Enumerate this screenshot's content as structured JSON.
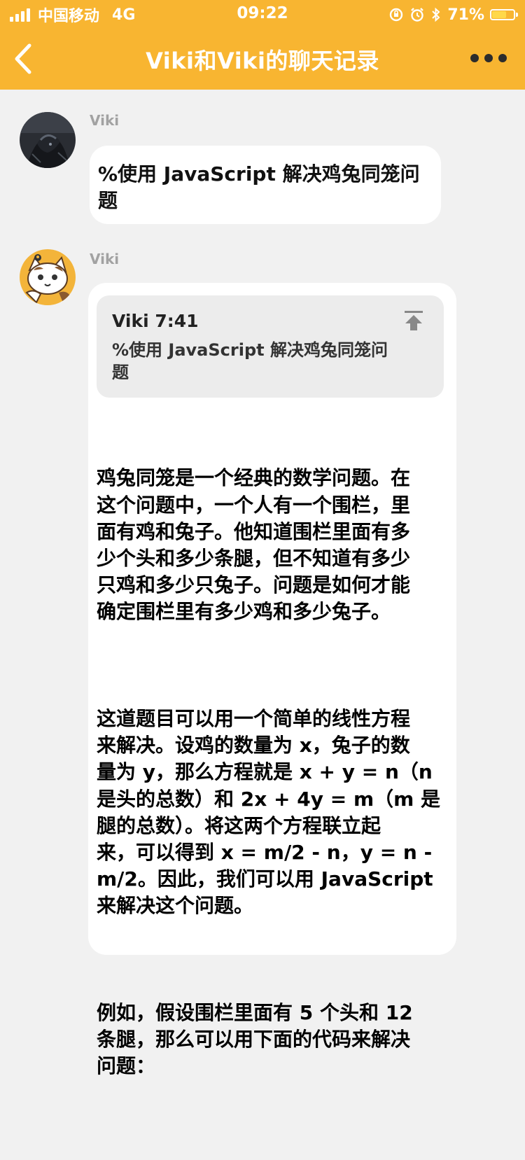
{
  "status_bar": {
    "carrier": "中国移动",
    "network": "4G",
    "time": "09:22",
    "battery_percent": "71%",
    "battery_level": 0.71,
    "battery_color": "#ffd84a"
  },
  "nav": {
    "title": "Viki和Viki的聊天记录",
    "background": "#f8b531"
  },
  "messages": [
    {
      "sender": "Viki",
      "avatar": "dark-anime-avatar",
      "text": "%使用 JavaScript 解决鸡兔同笼问\n题"
    },
    {
      "sender": "Viki",
      "avatar": "cat-avatar",
      "quote": {
        "header": "Viki 7:41",
        "text": "%使用 JavaScript 解决鸡兔同笼问\n题"
      },
      "paragraphs": [
        "鸡兔同笼是一个经典的数学问题。在\n这个问题中，一个人有一个围栏，里\n面有鸡和兔子。他知道围栏里面有多\n少个头和多少条腿，但不知道有多少\n只鸡和多少只兔子。问题是如何才能\n确定围栏里有多少鸡和多少兔子。",
        "这道题目可以用一个简单的线性方程\n来解决。设鸡的数量为 x，兔子的数\n量为 y，那么方程就是 x + y = n（n\n是头的总数）和 2x + 4y = m（m 是\n腿的总数）。将这两个方程联立起\n来，可以得到 x = m/2 - n，y = n -\nm/2。因此，我们可以用 JavaScript\n来解决这个问题。",
        "例如，假设围栏里面有 5 个头和 12\n条腿，那么可以用下面的代码来解决\n问题："
      ]
    }
  ]
}
